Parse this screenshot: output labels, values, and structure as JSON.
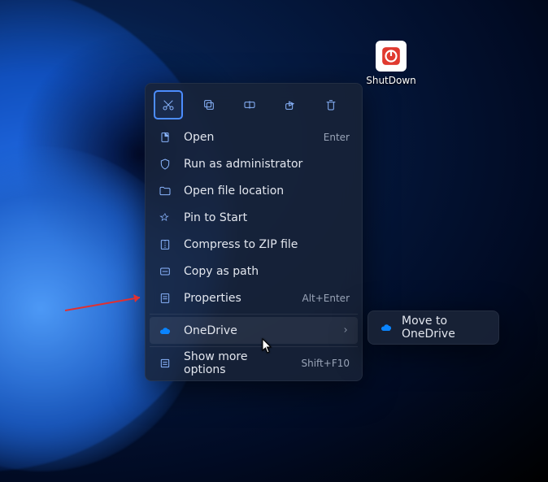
{
  "desktop": {
    "icon_label": "ShutDown"
  },
  "menu": {
    "toolbar": [
      {
        "name": "cut-icon"
      },
      {
        "name": "copy-icon"
      },
      {
        "name": "rename-icon"
      },
      {
        "name": "share-icon"
      },
      {
        "name": "delete-icon"
      }
    ],
    "items": {
      "open": {
        "label": "Open",
        "shortcut": "Enter"
      },
      "run_admin": {
        "label": "Run as administrator"
      },
      "open_location": {
        "label": "Open file location"
      },
      "pin_start": {
        "label": "Pin to Start"
      },
      "compress": {
        "label": "Compress to ZIP file"
      },
      "copy_path": {
        "label": "Copy as path"
      },
      "properties": {
        "label": "Properties",
        "shortcut": "Alt+Enter"
      },
      "onedrive": {
        "label": "OneDrive"
      },
      "show_more": {
        "label": "Show more options",
        "shortcut": "Shift+F10"
      }
    }
  },
  "submenu": {
    "move": {
      "label": "Move to OneDrive"
    }
  }
}
